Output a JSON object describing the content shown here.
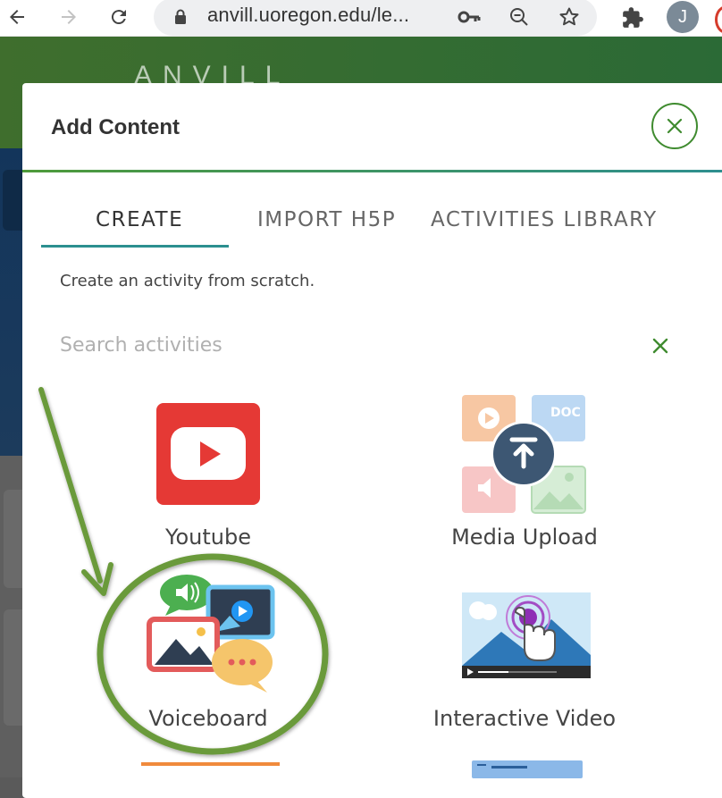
{
  "browser": {
    "url": "anvill.uoregon.edu/le...",
    "profile_initial": "J",
    "icons": [
      "back-icon",
      "forward-icon",
      "reload-icon",
      "lock-icon",
      "key-icon",
      "zoom-icon",
      "star-icon",
      "extensions-icon"
    ]
  },
  "background": {
    "logo_text": "ANVILL"
  },
  "modal": {
    "title": "Add Content",
    "tabs": [
      {
        "label": "CREATE",
        "active": true
      },
      {
        "label": "IMPORT H5P",
        "active": false
      },
      {
        "label": "ACTIVITIES LIBRARY",
        "active": false
      }
    ],
    "subtitle": "Create an activity from scratch.",
    "search_placeholder": "Search activities",
    "activities": [
      {
        "label": "Youtube"
      },
      {
        "label": "Media Upload",
        "doc_text": "DOC"
      },
      {
        "label": "Voiceboard"
      },
      {
        "label": "Interactive Video"
      }
    ]
  },
  "colors": {
    "accent_green": "#3f8b2f",
    "tab_underline": "#2b8f8f",
    "annotation_green": "#6a9a3a",
    "youtube_red": "#e53935"
  }
}
